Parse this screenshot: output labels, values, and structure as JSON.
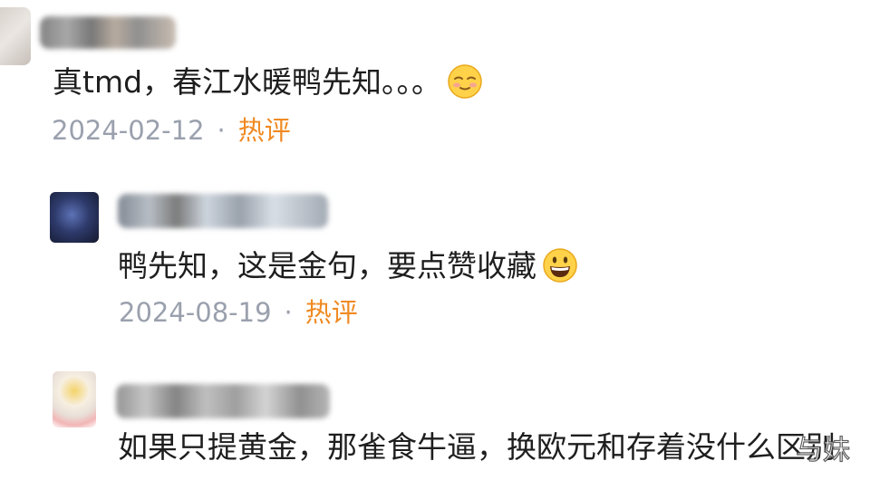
{
  "comments": [
    {
      "text": "真tmd，春江水暖鸭先知。。。",
      "emoji": "blush-emoji",
      "date": "2024-02-12",
      "separator": "·",
      "tag": "热评"
    },
    {
      "text": "鸭先知，这是金句，要点赞收藏",
      "emoji": "grin-emoji",
      "date": "2024-08-19",
      "separator": "·",
      "tag": "热评"
    },
    {
      "text": "如果只提黄金，那雀食牛逼，换欧元和存着没什么区别"
    }
  ],
  "watermark": "与妹",
  "colors": {
    "text": "#1e1e1e",
    "date": "#9aa0ad",
    "hot_tag": "#f08a22"
  }
}
